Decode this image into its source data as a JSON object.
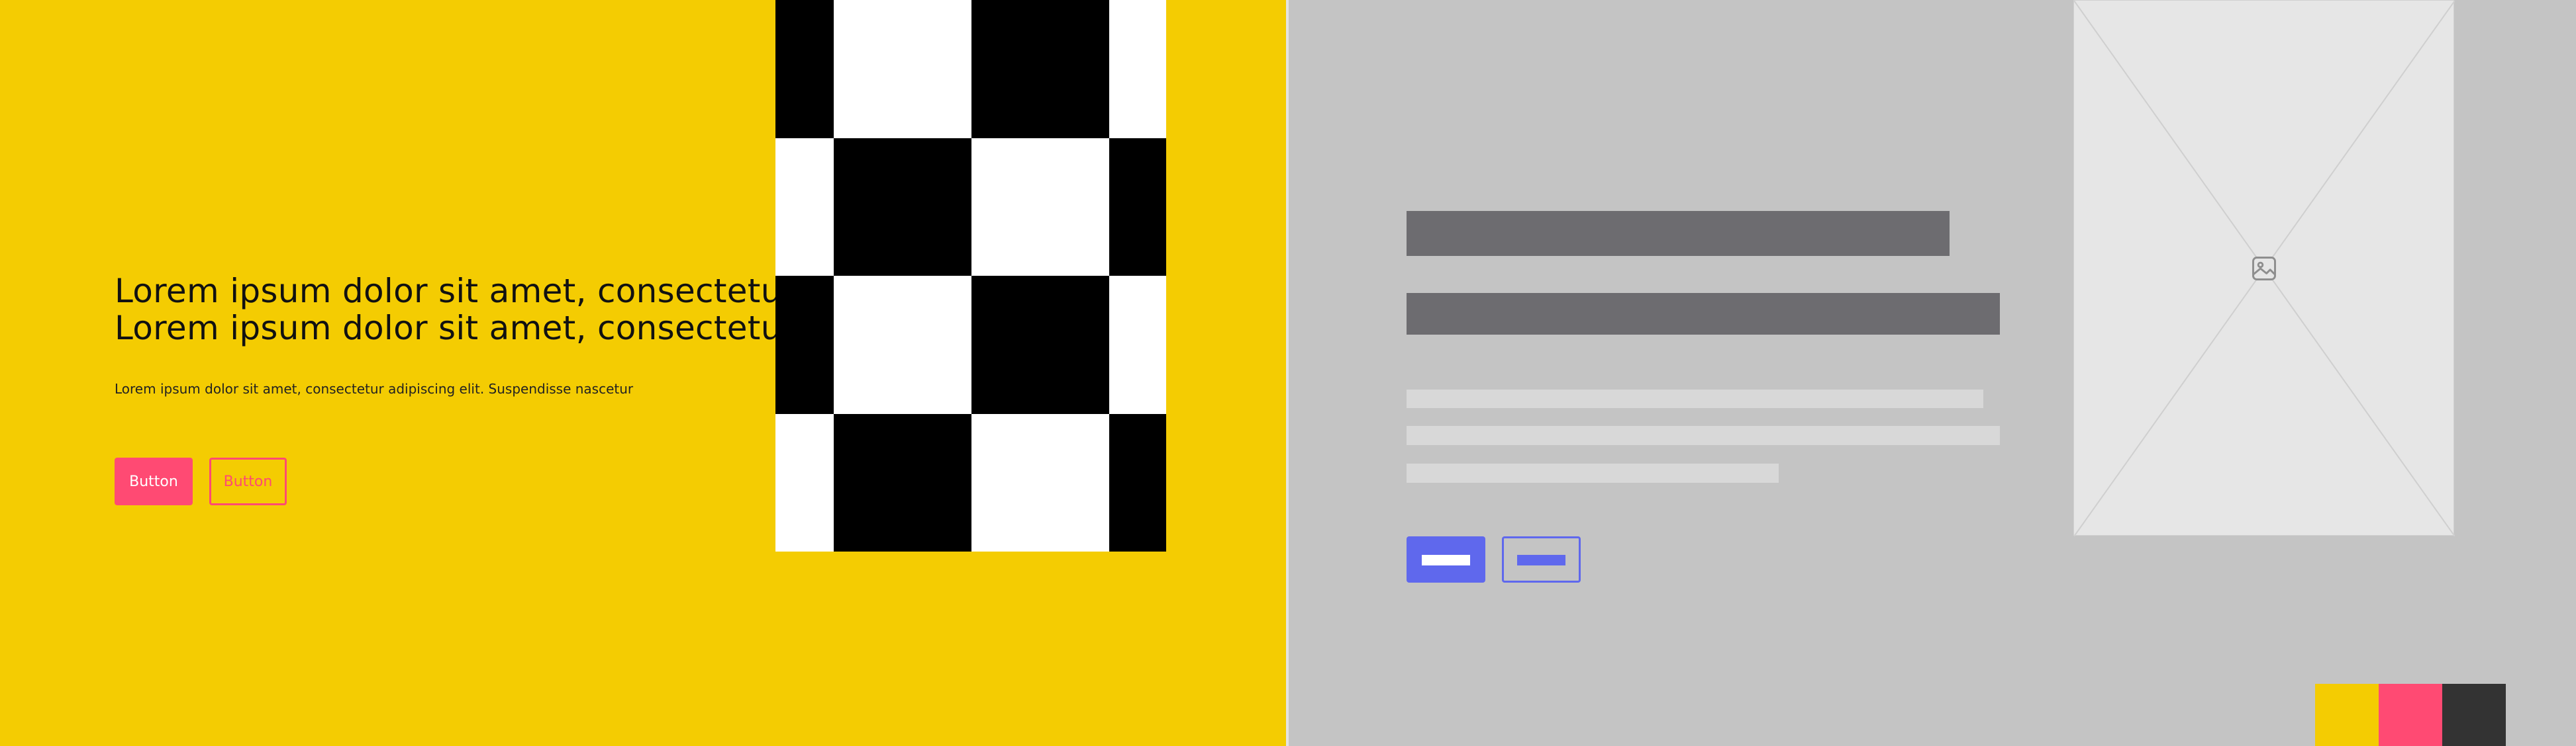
{
  "hero": {
    "headline_line1": "Lorem ipsum dolor sit amet, consectetur",
    "headline_line2": "Lorem ipsum dolor sit amet, consectetur",
    "subtext": "Lorem ipsum dolor sit amet, consectetur adipiscing elit. Suspendisse nascetur",
    "primary_button": "Button",
    "secondary_button": "Button",
    "bg_color": "#f4cc02",
    "accent_color": "#ff4a73"
  },
  "checker_image": {
    "colors": [
      "#000000",
      "#ffffff"
    ]
  },
  "wireframe": {
    "bg_color": "#c4c4c4",
    "bar_color": "#6d6c70",
    "line_color": "#d8d8d8",
    "button_color": "#5f68ed",
    "image_placeholder_icon": "image-icon"
  },
  "swatches": [
    "#f4cc02",
    "#ff4a73",
    "#333333"
  ]
}
